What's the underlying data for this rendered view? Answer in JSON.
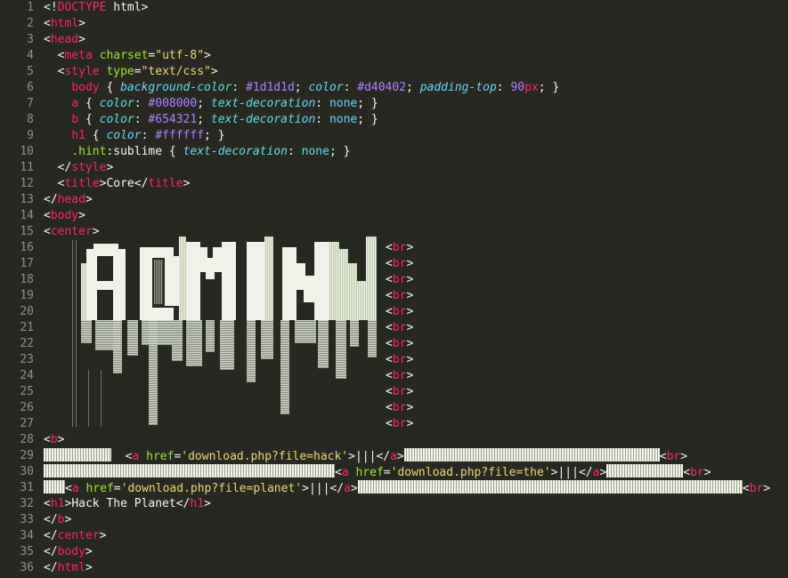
{
  "line_numbers": [
    "1",
    "2",
    "3",
    "4",
    "5",
    "6",
    "7",
    "8",
    "9",
    "10",
    "11",
    "12",
    "13",
    "14",
    "15",
    "16",
    "17",
    "18",
    "19",
    "20",
    "21",
    "22",
    "23",
    "24",
    "25",
    "26",
    "27",
    "28",
    "29",
    "30",
    "31",
    "32",
    "33",
    "34",
    "35",
    "36"
  ],
  "code": {
    "doctype_open": "<!",
    "doctype_kw": "DOCTYPE",
    "doctype_rest": " html>",
    "lt": "<",
    "gt": ">",
    "lt_slash": "</",
    "html": "html",
    "head": "head",
    "meta": "meta",
    "charset_attr": "charset",
    "charset_val": "\"utf-8\"",
    "style": "style",
    "type_attr": "type",
    "type_val": "\"text/css\"",
    "body_sel": "body",
    "bg_prop": "background-color",
    "bg_val": "#1d1d1d",
    "color_prop": "color",
    "body_color_val": "#d40402",
    "padding_prop": "padding-top",
    "padding_num": "90",
    "padding_unit": "px",
    "a_sel": "a",
    "a_color_val": "#008000",
    "td_prop": "text-decoration",
    "none_val": "none",
    "b_sel": "b",
    "b_color_val": "#654321",
    "h1_sel": "h1",
    "h1_color_val": "#ffffff",
    "hint_sel": ".hint",
    "hint_pseudo": ":sublime",
    "title": "title",
    "title_text": "Core",
    "body": "body",
    "center": "center",
    "br": "br",
    "b_tag": "b",
    "a_tag": "a",
    "href_attr": "href",
    "href_hack": "'download.php?file=hack'",
    "href_the": "'download.php?file=the'",
    "href_planet": "'download.php?file=planet'",
    "pipes": "|||",
    "h1_tag": "h1",
    "h1_text": "Hack The Planet"
  },
  "ascii_art_word": "ADMIN",
  "colors": {
    "editor_bg": "#272822",
    "tag": "#f92672",
    "attr": "#a6e22e",
    "string": "#e6db74",
    "property": "#66d9ef",
    "number": "#ae81ff",
    "text": "#f8f8f2",
    "gutter": "#90908a"
  }
}
